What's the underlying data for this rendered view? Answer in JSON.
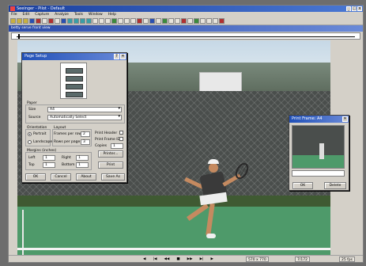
{
  "app": {
    "title": "Seeinger - Pilot - Default",
    "menu": [
      "File",
      "Edit",
      "Capture",
      "Analyze",
      "Tools",
      "Window",
      "Help"
    ],
    "document_tab": "betty serve front view"
  },
  "statusbar": {
    "controls": [
      "◀",
      "|◀",
      "◀◀",
      "■",
      "▶▶",
      "▶|",
      "▶"
    ],
    "frame_size": "570 x 770",
    "frame_pos": "7/172",
    "fps": "25 fps"
  },
  "page_setup": {
    "title": "Page Setup",
    "help": "?",
    "close": "✕",
    "paper_group": "Paper",
    "size_label": "Size",
    "size_value": "A4",
    "source_label": "Source",
    "source_value": "Automatically Select",
    "orientation_group": "Orientation",
    "portrait": "Portrait",
    "landscape": "Landscape",
    "layout_group": "Layout",
    "frames_per_row_label": "Frames per row",
    "frames_per_row": "2",
    "rows_per_page_label": "Rows per page",
    "rows_per_page": "3",
    "print_header": "Print Header",
    "print_frame_id": "Print Frame ID",
    "copies_label": "Copies",
    "copies": "1",
    "margins_group": "Margins (inches)",
    "left_label": "Left",
    "right_label": "Right",
    "top_label": "Top",
    "bottom_label": "Bottom",
    "left": "1",
    "right": "1",
    "top": "1",
    "bottom": "1",
    "printer_button": "Printer...",
    "print_button": "Print",
    "ok": "OK",
    "cancel": "Cancel",
    "about": "About",
    "save_as": "Save As"
  },
  "print_frame": {
    "title": "Print Frame: A4",
    "close": "✕",
    "ok": "OK",
    "delete": "Delete"
  }
}
